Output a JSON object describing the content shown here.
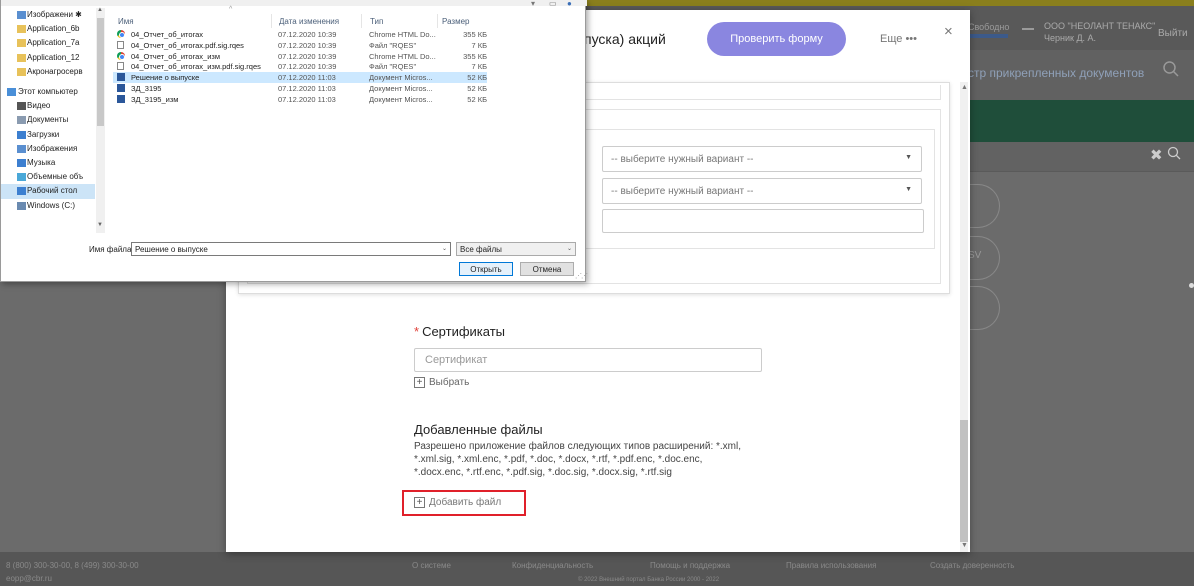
{
  "background": {
    "status": "Свободно",
    "org_line1": "ООО \"НЕОЛАНТ ТЕНАКС\"",
    "org_line2": "Черник Д. А.",
    "exit_label": "Выйти",
    "sublink": "стр прикрепленных документов",
    "sv_label": "SV",
    "footer": {
      "phone": "8 (800) 300-30-00, 8 (499) 300-30-00",
      "email": "eopp@cbr.ru",
      "links": [
        "О системе",
        "Конфиденциальность",
        "Помощь и поддержка",
        "Правила использования",
        "Создать доверенность"
      ],
      "copyright": "© 2022 Внешний портал Банка России 2000 - 2022"
    }
  },
  "modal": {
    "title_partial": "пуска) акций",
    "check_button": "Проверить форму",
    "more": "Еще •••",
    "close": "×",
    "select1_placeholder": "-- выберите нужный вариант --",
    "select2_placeholder": "-- выберите нужный вариант --",
    "cert_required_mark": "*",
    "cert_label": "Сертификаты",
    "cert_placeholder": "Сертификат",
    "select_link": "Выбрать",
    "files_title": "Добавленные файлы",
    "files_desc": "Разрешено приложение файлов следующих типов расширений: *.xml, *.xml.sig, *.xml.enc, *.pdf, *.doc, *.docx, *.rtf, *.pdf.enc, *.doc.enc, *.docx.enc, *.rtf.enc, *.pdf.sig, *.doc.sig, *.docx.sig, *.rtf.sig",
    "add_file": "Добавить файл"
  },
  "file_dialog": {
    "nav_items": [
      {
        "label": "Изображени ✱",
        "kind": "sub",
        "icon_color": "#5a8fd0"
      },
      {
        "label": "Application_6b",
        "kind": "sub",
        "icon_color": "#e8c25a"
      },
      {
        "label": "Application_7a",
        "kind": "sub",
        "icon_color": "#e8c25a"
      },
      {
        "label": "Application_12",
        "kind": "sub",
        "icon_color": "#e8c25a"
      },
      {
        "label": "Акронагросерв",
        "kind": "sub",
        "icon_color": "#e8c25a"
      },
      {
        "label": "Этот компьютер",
        "kind": "top",
        "icon_color": "#4a8fd8"
      },
      {
        "label": "Видео",
        "kind": "sub",
        "icon_color": "#555555"
      },
      {
        "label": "Документы",
        "kind": "sub",
        "icon_color": "#8a9bb0"
      },
      {
        "label": "Загрузки",
        "kind": "sub",
        "icon_color": "#3c7fd0"
      },
      {
        "label": "Изображения",
        "kind": "sub",
        "icon_color": "#5a8fd0"
      },
      {
        "label": "Музыка",
        "kind": "sub",
        "icon_color": "#3c7fd0"
      },
      {
        "label": "Объемные объ",
        "kind": "sub",
        "icon_color": "#4aa8d8"
      },
      {
        "label": "Рабочий стол",
        "kind": "sub",
        "icon_color": "#3c7fd0",
        "selected": true
      },
      {
        "label": "Windows (C:)",
        "kind": "sub",
        "icon_color": "#6a8ab0"
      }
    ],
    "columns": {
      "name": "Имя",
      "date": "Дата изменения",
      "type": "Тип",
      "size": "Размер"
    },
    "files": [
      {
        "name": "04_Отчет_об_итогах",
        "date": "07.12.2020 10:39",
        "type": "Chrome HTML Do...",
        "size": "355 КБ",
        "icon": "chrome"
      },
      {
        "name": "04_Отчет_об_итогах.pdf.sig.rqes",
        "date": "07.12.2020 10:39",
        "type": "Файл \"RQES\"",
        "size": "7 КБ",
        "icon": "doc"
      },
      {
        "name": "04_Отчет_об_итогах_изм",
        "date": "07.12.2020 10:39",
        "type": "Chrome HTML Do...",
        "size": "355 КБ",
        "icon": "chrome"
      },
      {
        "name": "04_Отчет_об_итогах_изм.pdf.sig.rqes",
        "date": "07.12.2020 10:39",
        "type": "Файл \"RQES\"",
        "size": "7 КБ",
        "icon": "doc"
      },
      {
        "name": "Решение о выпуске",
        "date": "07.12.2020 11:03",
        "type": "Документ Micros...",
        "size": "52 КБ",
        "icon": "word",
        "selected": true
      },
      {
        "name": "ЗД_3195",
        "date": "07.12.2020 11:03",
        "type": "Документ Micros...",
        "size": "52 КБ",
        "icon": "word"
      },
      {
        "name": "ЗД_3195_изм",
        "date": "07.12.2020 11:03",
        "type": "Документ Micros...",
        "size": "52 КБ",
        "icon": "word"
      }
    ],
    "filename_label": "Имя файла:",
    "filename_value": "Решение о выпуске",
    "filetype_value": "Все файлы",
    "open_button": "Открыть",
    "cancel_button": "Отмена"
  }
}
